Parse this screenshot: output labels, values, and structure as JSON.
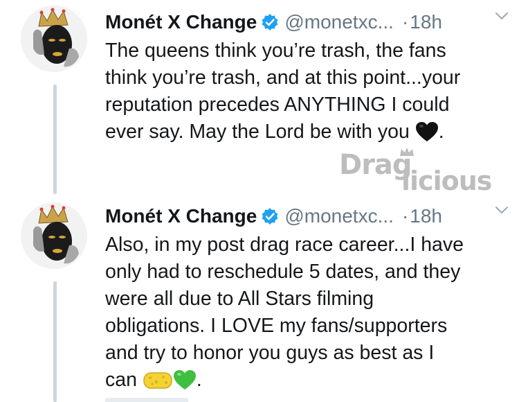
{
  "tweets": [
    {
      "author_name": "Monét X Change",
      "handle": "@monetxc...",
      "separator": "·",
      "time": "18h",
      "lines": [
        "The queens think you’re trash, the fans",
        "think you’re trash, and at this point...your",
        "reputation precedes ANYTHING I could",
        "ever say. May the Lord be with you",
        "."
      ],
      "emojis": [
        "black-heart-emoji"
      ]
    },
    {
      "author_name": "Monét X Change",
      "handle": "@monetxc...",
      "separator": "·",
      "time": "18h",
      "lines": [
        "Also, in my post drag race career...I have",
        "only had to reschedule 5 dates, and they",
        "were all due to All Stars filming",
        "obligations. I LOVE my fans/supporters",
        "and try to honor you guys as best as I",
        "can",
        "."
      ],
      "emojis": [
        "sponge-emoji",
        "green-heart-emoji"
      ]
    }
  ],
  "watermark": {
    "part1": "Drag",
    "part2": "licious"
  },
  "colors": {
    "text": "#14171a",
    "secondary": "#657786",
    "verified": "#1da1f2",
    "thread_line": "#ccd6dd",
    "watermark": "#bdbdbd"
  }
}
